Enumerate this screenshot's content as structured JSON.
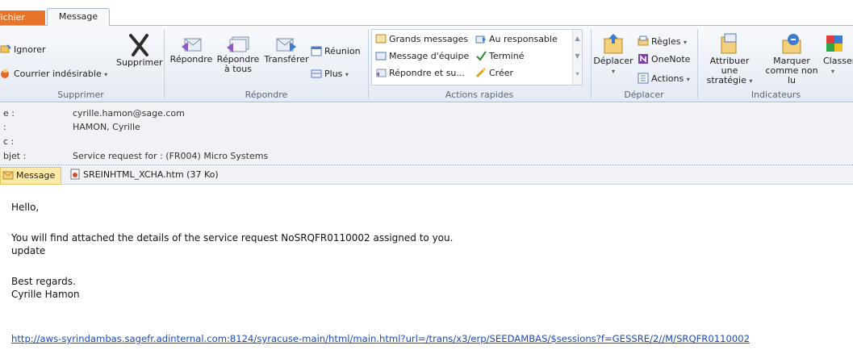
{
  "tabs": {
    "file": "Fichier",
    "message": "Message"
  },
  "ribbon": {
    "supprimer": {
      "ignorer": "Ignorer",
      "courrier": "Courrier indésirable",
      "supprimer": "Supprimer",
      "label": "Supprimer"
    },
    "repondre": {
      "repondre": "Répondre",
      "repondre_tous_1": "Répondre",
      "repondre_tous_2": "à tous",
      "transferer": "Transférer",
      "reunion": "Réunion",
      "plus": "Plus",
      "label": "Répondre"
    },
    "actions_rapides": {
      "items": [
        "Grands messages",
        "Au responsable",
        "Message d'équipe",
        "Terminé",
        "Répondre et su...",
        "Créer"
      ],
      "label": "Actions rapides"
    },
    "deplacer": {
      "deplacer": "Déplacer",
      "regles": "Règles",
      "onenote": "OneNote",
      "actions": "Actions",
      "label": "Déplacer"
    },
    "indicateurs": {
      "attribuer_1": "Attribuer une",
      "attribuer_2": "stratégie",
      "marquer_1": "Marquer",
      "marquer_2": "comme non lu",
      "classer": "Classer",
      "label": "Indicateurs"
    }
  },
  "header": {
    "from_label": "e :",
    "from": "cyrille.hamon@sage.com",
    "to_label": ":",
    "to": "HAMON, Cyrille",
    "cc_label": "c :",
    "cc": "",
    "subject_label": "bjet :",
    "subject": "Service request for : (FR004) Micro Systems",
    "att_message": "Message",
    "att_file": "SREINHTML_XCHA.htm (37 Ko)"
  },
  "body": {
    "greeting": "Hello,",
    "line1": "You will find attached the details of the service request NoSRQFR0110002  assigned to you.",
    "line2": "update",
    "regards": "Best regards.",
    "signature": "Cyrille Hamon",
    "link": "http://aws-syrindambas.sagefr.adinternal.com:8124/syracuse-main/html/main.html?url=/trans/x3/erp/SEEDAMBAS/$sessions?f=GESSRE/2//M/SRQFR0110002"
  }
}
